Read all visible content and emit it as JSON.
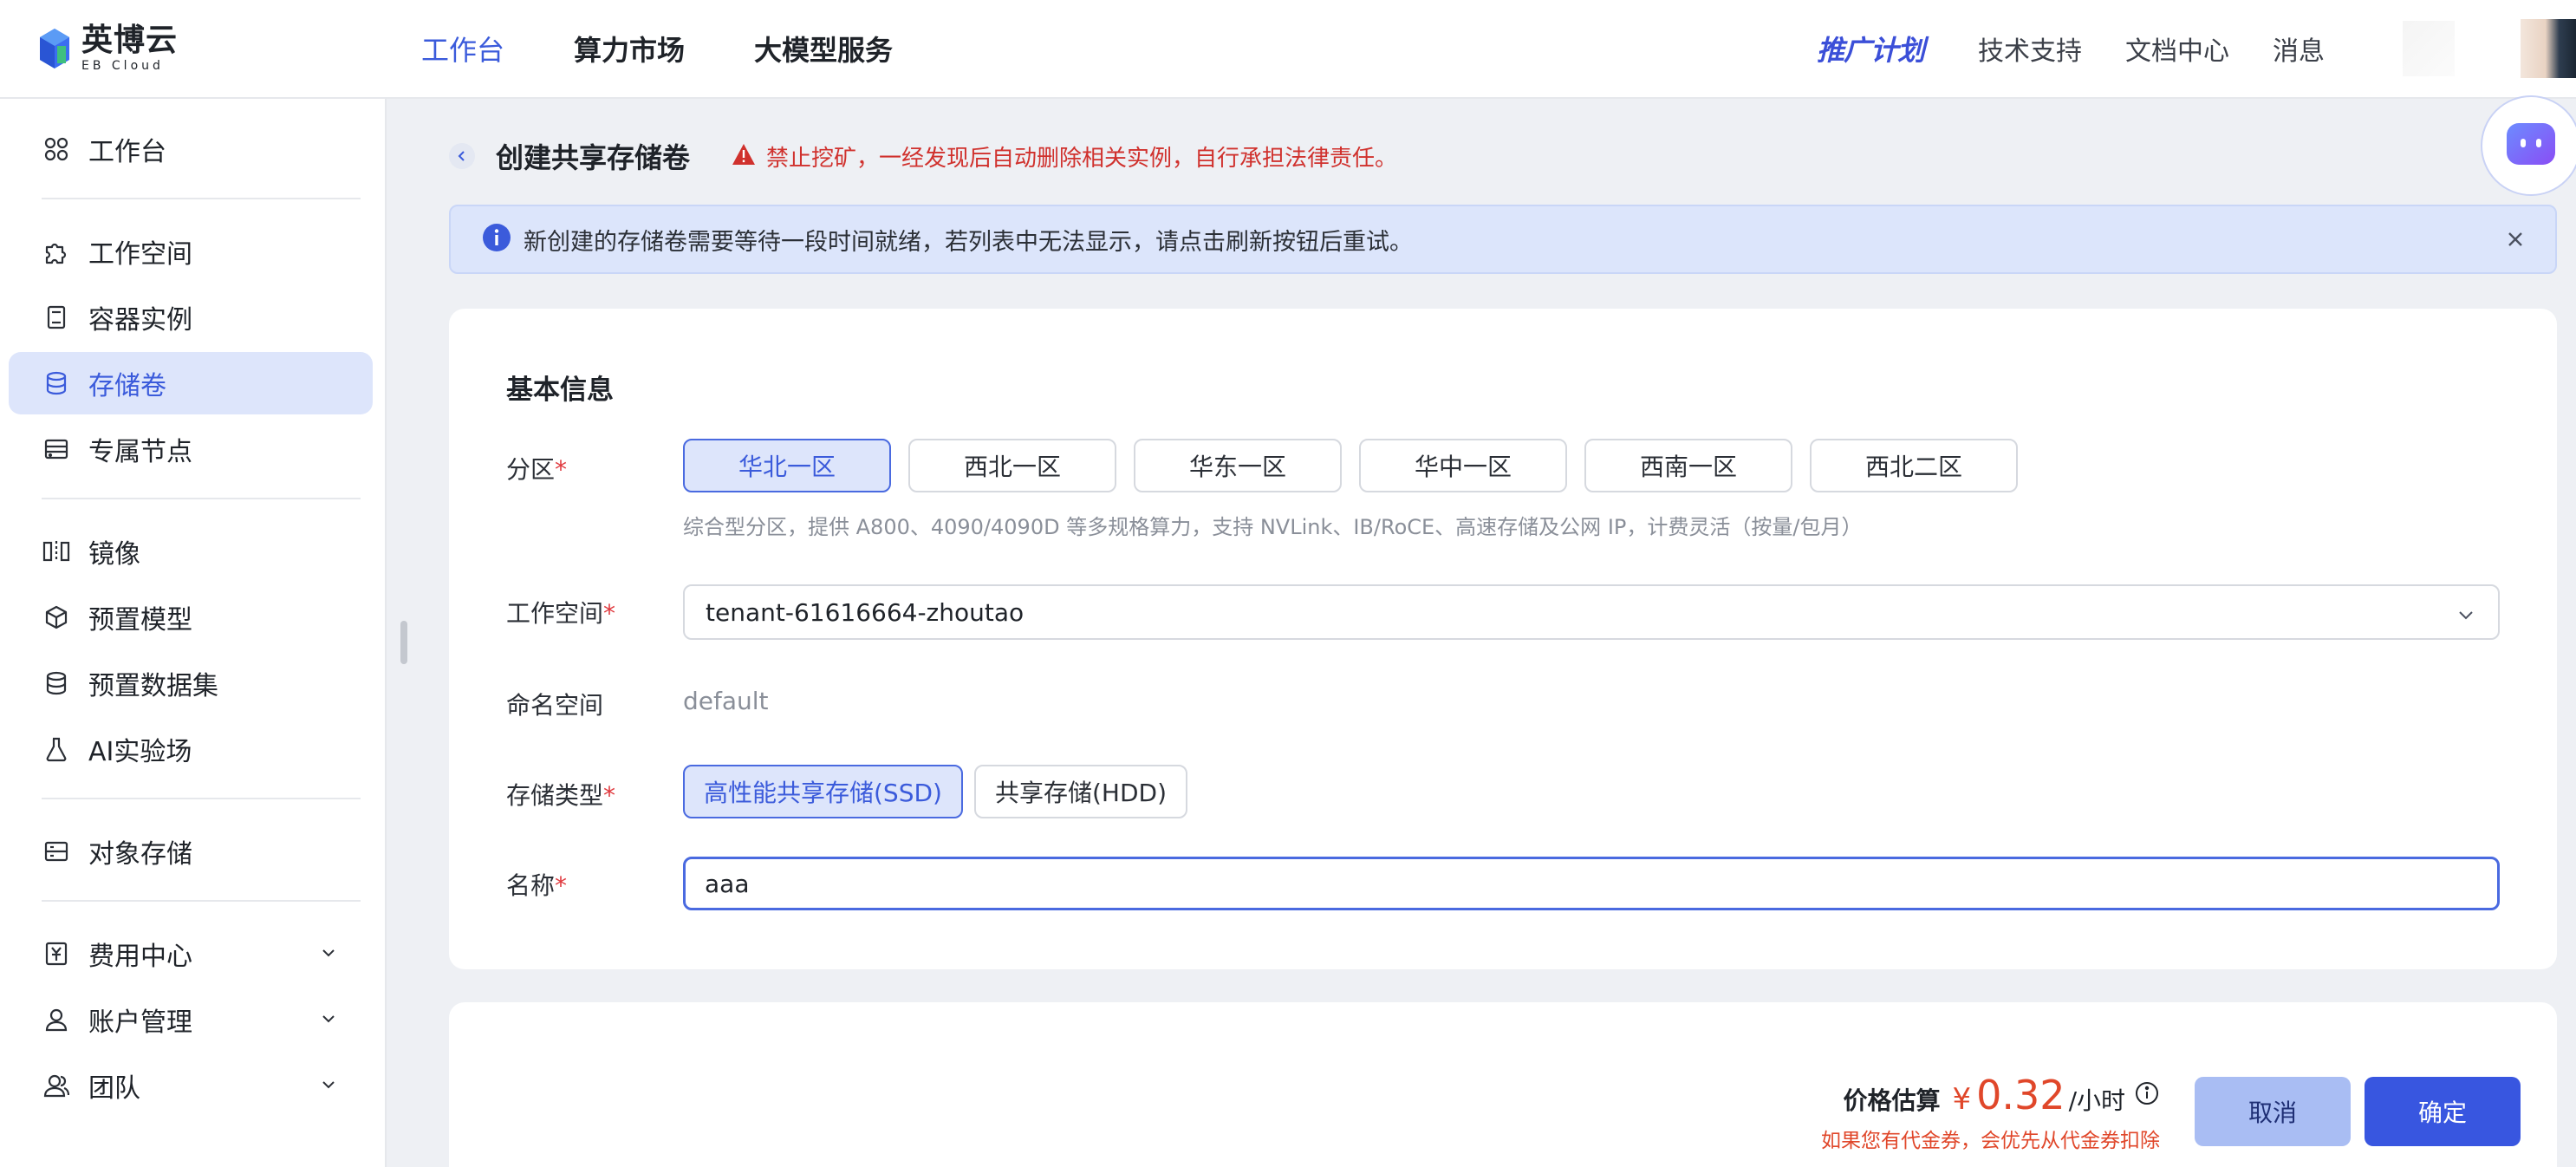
{
  "brand": {
    "name_cn": "英博云",
    "name_en": "EB Cloud"
  },
  "topnav": {
    "items": [
      {
        "label": "工作台",
        "active": true
      },
      {
        "label": "算力市场",
        "active": false
      },
      {
        "label": "大模型服务",
        "active": false
      }
    ],
    "promo": "推广计划",
    "links": [
      "技术支持",
      "文档中心",
      "消息"
    ]
  },
  "sidebar": {
    "items": [
      {
        "label": "工作台",
        "icon": "grid-icon"
      },
      {
        "label": "工作空间",
        "icon": "puzzle-icon"
      },
      {
        "label": "容器实例",
        "icon": "container-icon"
      },
      {
        "label": "存储卷",
        "icon": "database-icon",
        "active": true
      },
      {
        "label": "专属节点",
        "icon": "server-icon"
      },
      {
        "label": "镜像",
        "icon": "mirror-icon"
      },
      {
        "label": "预置模型",
        "icon": "cube-icon"
      },
      {
        "label": "预置数据集",
        "icon": "dataset-icon"
      },
      {
        "label": "AI实验场",
        "icon": "flask-icon"
      },
      {
        "label": "对象存储",
        "icon": "object-storage-icon"
      },
      {
        "label": "费用中心",
        "icon": "yen-icon",
        "expandable": true
      },
      {
        "label": "账户管理",
        "icon": "user-icon",
        "expandable": true
      },
      {
        "label": "团队",
        "icon": "team-icon",
        "expandable": true
      }
    ]
  },
  "page": {
    "title": "创建共享存储卷",
    "warning": "禁止挖矿，一经发现后自动删除相关实例，自行承担法律责任。",
    "info": "新创建的存储卷需要等待一段时间就绪，若列表中无法显示，请点击刷新按钮后重试。"
  },
  "form": {
    "section_title": "基本信息",
    "region": {
      "label": "分区",
      "options": [
        "华北一区",
        "西北一区",
        "华东一区",
        "华中一区",
        "西南一区",
        "西北二区"
      ],
      "selected": "华北一区",
      "hint": "综合型分区，提供 A800、4090/4090D 等多规格算力，支持 NVLink、IB/RoCE、高速存储及公网 IP，计费灵活（按量/包月）"
    },
    "workspace": {
      "label": "工作空间",
      "value": "tenant-61616664-zhoutao"
    },
    "namespace": {
      "label": "命名空间",
      "value": "default"
    },
    "storage_type": {
      "label": "存储类型",
      "options": [
        "高性能共享存储(SSD)",
        "共享存储(HDD)"
      ],
      "selected": "高性能共享存储(SSD)"
    },
    "name": {
      "label": "名称",
      "value": "aaa"
    },
    "required_mark": "*"
  },
  "footer": {
    "price_label": "价格估算",
    "currency": "¥",
    "price": "0.32",
    "unit": "/小时",
    "coupon_note": "如果您有代金券，会优先从代金券扣除",
    "cancel": "取消",
    "confirm": "确定"
  },
  "colors": {
    "accent": "#3b5bdb",
    "danger": "#d0312d",
    "price": "#e0472a"
  }
}
